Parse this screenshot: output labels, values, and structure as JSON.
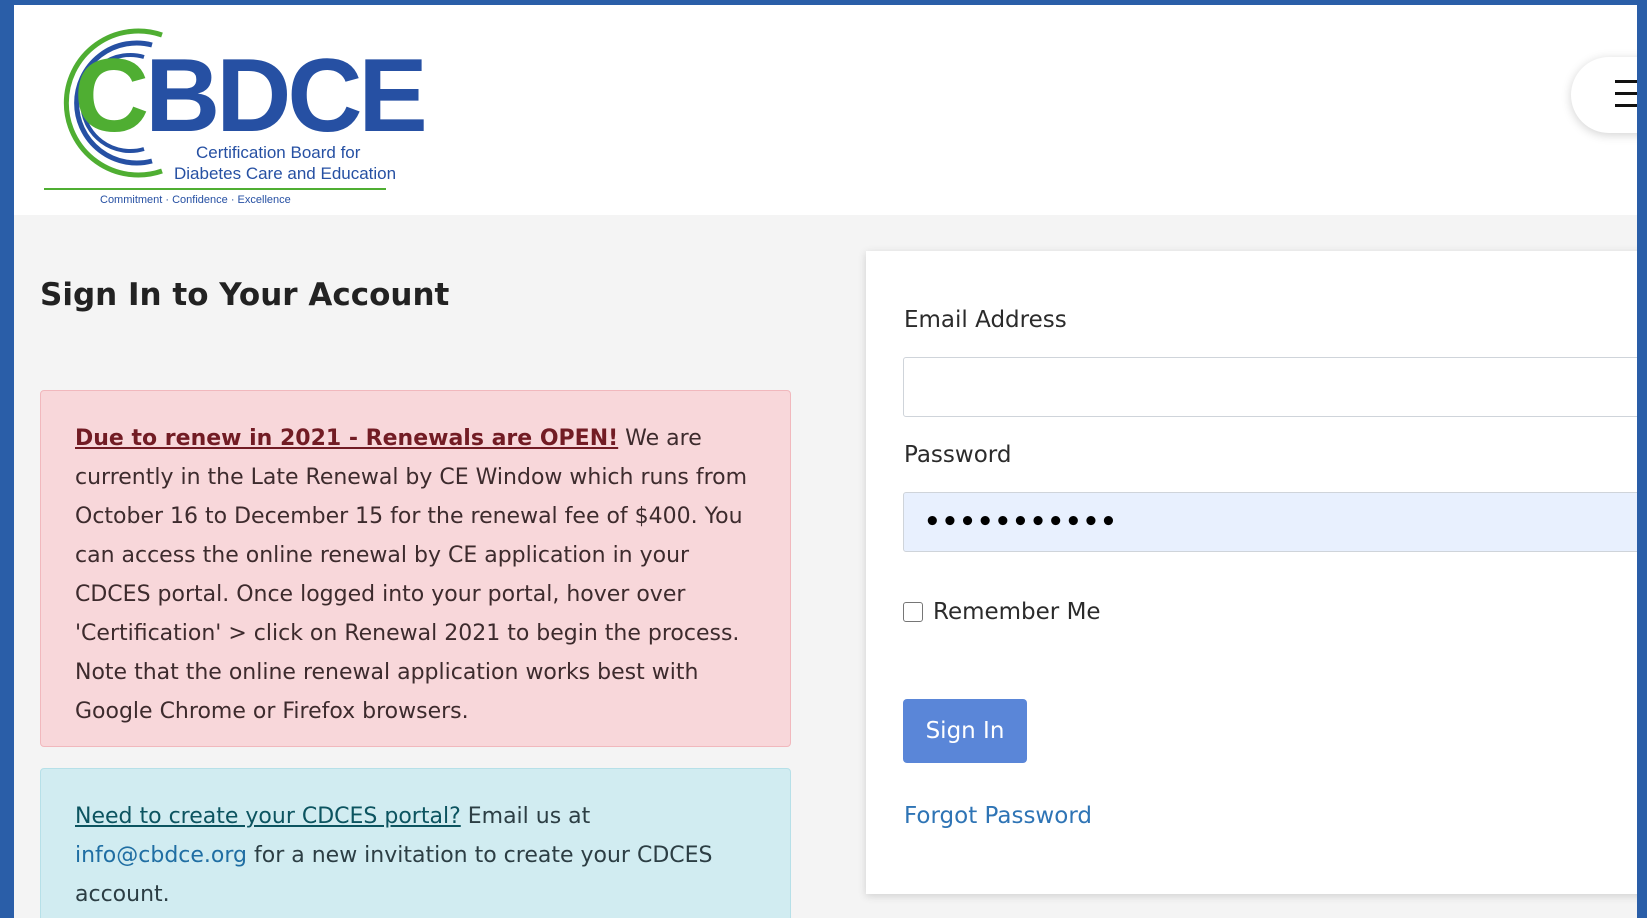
{
  "header": {
    "logo": {
      "wordmark": "CBDCE",
      "subtitle_line1": "Certification Board for",
      "subtitle_line2": "Diabetes Care and Education",
      "tagline": "Commitment · Confidence · Excellence"
    },
    "menu_icon": "hamburger-menu-icon"
  },
  "page": {
    "title": "Sign In to Your Account"
  },
  "renewal_notice": {
    "lead": "Due to renew in 2021 - Renewals are OPEN!",
    "body": " We are currently in the Late Renewal by CE Window which runs from October 16 to December 15 for the renewal fee of $400. You can access the online renewal by CE application in your CDCES portal.  Once logged into your portal, hover over 'Certification' > click on Renewal 2021 to begin the process.  Note that the online renewal application works best with Google Chrome or Firefox browsers."
  },
  "portal_notice": {
    "lead": "Need to create your CDCES portal?",
    "text1": " Email us at ",
    "email": "info@cbdce.org",
    "text2": " for a new invitation to create your CDCES account."
  },
  "form": {
    "email_label": "Email Address",
    "email_value": "",
    "password_label": "Password",
    "password_value": "•••••••••••",
    "remember_label": "Remember Me",
    "signin_label": "Sign In",
    "forgot_label": "Forgot Password"
  },
  "colors": {
    "logo_blue": "#2650a3",
    "logo_green": "#4fae32",
    "primary_button": "#5a86d8",
    "frame_blue": "#2a5ea8"
  }
}
